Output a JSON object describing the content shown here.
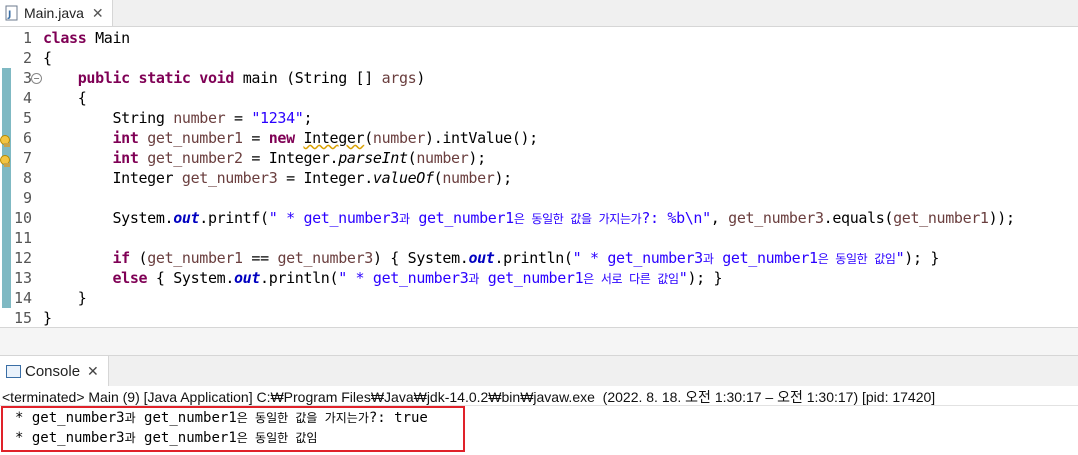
{
  "editor_tab": {
    "label": "Main.java",
    "close": "✕"
  },
  "lines": [
    {
      "n": "1"
    },
    {
      "n": "2"
    },
    {
      "n": "3"
    },
    {
      "n": "4"
    },
    {
      "n": "5"
    },
    {
      "n": "6"
    },
    {
      "n": "7"
    },
    {
      "n": "8"
    },
    {
      "n": "9"
    },
    {
      "n": "10"
    },
    {
      "n": "11"
    },
    {
      "n": "12"
    },
    {
      "n": "13"
    },
    {
      "n": "14"
    },
    {
      "n": "15"
    }
  ],
  "code": {
    "l1_kw": "class",
    "l1_rest": " Main",
    "l2": "{",
    "l3_kw1": "public",
    "l3_kw2": "static",
    "l3_kw3": "void",
    "l3_rest1": " main (String [] ",
    "l3_var": "args",
    "l3_rest2": ")",
    "l4": "    {",
    "l5_a": "String ",
    "l5_var": "number",
    "l5_b": " = ",
    "l5_str": "\"1234\"",
    "l5_c": ";",
    "l6_kw": "int",
    "l6_var": "get_number1",
    "l6_b": " = ",
    "l6_kw2": "new",
    "l6_dep": "Integer",
    "l6_c": "(",
    "l6_var2": "number",
    "l6_d": ").intValue();",
    "l7_kw": "int",
    "l7_var": "get_number2",
    "l7_b": " = Integer.",
    "l7_it": "parseInt",
    "l7_c": "(",
    "l7_var2": "number",
    "l7_d": ");",
    "l8_a": "Integer ",
    "l8_var": "get_number3",
    "l8_b": " = Integer.",
    "l8_it": "valueOf",
    "l8_c": "(",
    "l8_var2": "number",
    "l8_d": ");",
    "l10_a": "System.",
    "l10_fld": "out",
    "l10_b": ".printf(",
    "l10_str1": "\" * get_number3",
    "l10_ko1": "과",
    "l10_str2": " get_number1",
    "l10_ko2": "은 동일한 값을 가지는가",
    "l10_str3": "?: %b\\n\"",
    "l10_c": ", ",
    "l10_var": "get_number3",
    "l10_d": ".equals(",
    "l10_var2": "get_number1",
    "l10_e": "));",
    "l12_kw": "if",
    "l12_a": " (",
    "l12_var": "get_number1",
    "l12_b": " == ",
    "l12_var2": "get_number3",
    "l12_c": ") { System.",
    "l12_fld": "out",
    "l12_d": ".println(",
    "l12_str1": "\" * get_number3",
    "l12_ko1": "과",
    "l12_str2": " get_number1",
    "l12_ko2": "은 동일한 값임",
    "l12_str3": "\"",
    "l12_e": "); }",
    "l13_kw": "else",
    "l13_a": " { System.",
    "l13_fld": "out",
    "l13_b": ".println(",
    "l13_str1": "\" * get_number3",
    "l13_ko1": "과",
    "l13_str2": " get_number1",
    "l13_ko2": "은 서로 다른 값임",
    "l13_str3": "\"",
    "l13_c": "); }",
    "l14": "    }",
    "l15": "}"
  },
  "console_tab": {
    "label": "Console",
    "close": "✕"
  },
  "status": "<terminated> Main (9) [Java Application] C:₩Program Files₩Java₩jdk-14.0.2₩bin₩javaw.exe  (2022. 8. 18. 오전 1:30:17 – 오전 1:30:17) [pid: 17420]",
  "output": {
    "line1_a": "* get_number3",
    "line1_ko1": "과",
    "line1_b": " get_number1",
    "line1_ko2": "은 동일한 값을 가지는가",
    "line1_c": "?: true",
    "line2_a": "* get_number3",
    "line2_ko1": "과",
    "line2_b": " get_number1",
    "line2_ko2": "은 동일한 값임"
  },
  "colors": {
    "keyword": "#7f0055",
    "string": "#2a00ff",
    "field": "#0000c0",
    "highlight_box": "#e0222a"
  }
}
